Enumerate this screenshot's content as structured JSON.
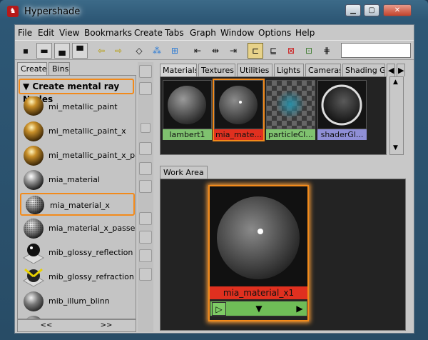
{
  "window": {
    "title": "Hypershade",
    "app_icon_glyph": "♞"
  },
  "menu": [
    "File",
    "Edit",
    "View",
    "Bookmarks",
    "Create",
    "Tabs",
    "Graph",
    "Window",
    "Options",
    "Help"
  ],
  "left_panel": {
    "tabs": [
      "Create",
      "Bins"
    ],
    "header": "Create mental ray Nodes",
    "items": [
      "mi_metallic_paint",
      "mi_metallic_paint_x",
      "mi_metallic_paint_x_passes",
      "mia_material",
      "mia_material_x",
      "mia_material_x_passes",
      "mib_glossy_reflection",
      "mib_glossy_refraction",
      "mib_illum_blinn"
    ],
    "scroll_left": "<<",
    "scroll_right": ">>"
  },
  "top_tabs": [
    "Materials",
    "Textures",
    "Utilities",
    "Lights",
    "Cameras",
    "Shading Gro"
  ],
  "swatches": [
    {
      "label": "lambert1",
      "color": "#7fc26f"
    },
    {
      "label": "mia_mate...",
      "color": "#e0301f"
    },
    {
      "label": "particleCl...",
      "color": "#7fc26f"
    },
    {
      "label": "shaderGl...",
      "color": "#8f8fd6"
    }
  ],
  "work_area": {
    "tab": "Work Area",
    "node_label": "mia_material_x1",
    "controls": [
      "▷",
      "▼",
      "▶"
    ]
  },
  "colors": {
    "highlight": "#f28a1b"
  }
}
